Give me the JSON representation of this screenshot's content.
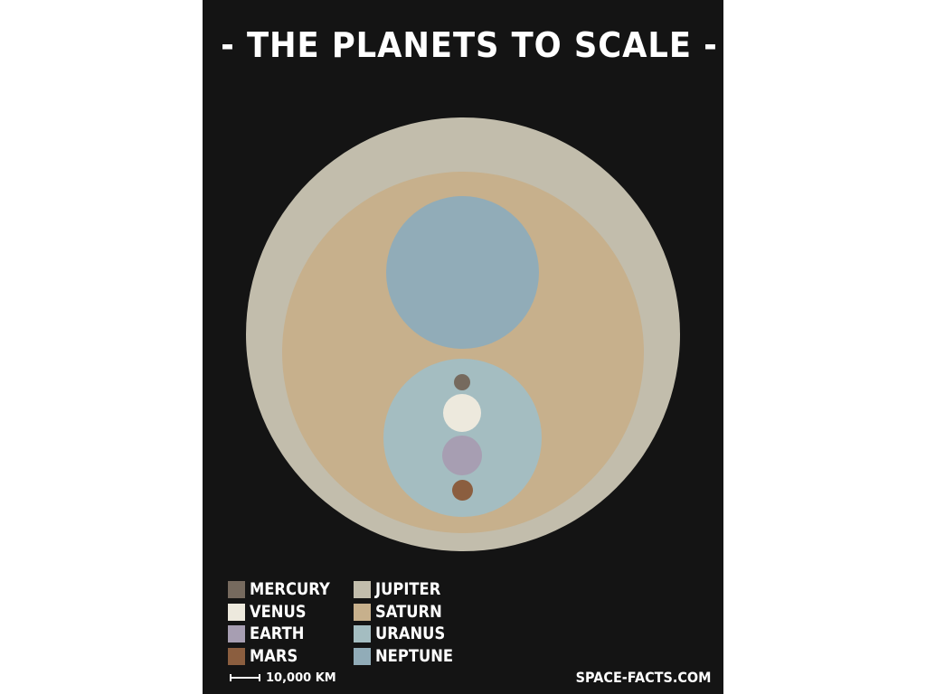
{
  "title": "- THE PLANETS TO SCALE -",
  "planets": {
    "jupiter": {
      "name": "JUPITER",
      "color": "#c2bdac"
    },
    "saturn": {
      "name": "SATURN",
      "color": "#c7b08c"
    },
    "uranus": {
      "name": "URANUS",
      "color": "#a4bdc1"
    },
    "neptune": {
      "name": "NEPTUNE",
      "color": "#91acb8"
    },
    "mercury": {
      "name": "MERCURY",
      "color": "#766a5e"
    },
    "venus": {
      "name": "VENUS",
      "color": "#ede9dd"
    },
    "earth": {
      "name": "EARTH",
      "color": "#a79eb2"
    },
    "mars": {
      "name": "MARS",
      "color": "#8b5e3f"
    }
  },
  "legend": [
    {
      "label": "MERCURY",
      "color": "#766a5e"
    },
    {
      "label": "VENUS",
      "color": "#ede9dd"
    },
    {
      "label": "EARTH",
      "color": "#a79eb2"
    },
    {
      "label": "MARS",
      "color": "#8b5e3f"
    },
    {
      "label": "JUPITER",
      "color": "#c2bdac"
    },
    {
      "label": "SATURN",
      "color": "#c7b08c"
    },
    {
      "label": "URANUS",
      "color": "#a4bdc1"
    },
    {
      "label": "NEPTUNE",
      "color": "#91acb8"
    }
  ],
  "scale_label": "10,000 KM",
  "credit": "SPACE-FACTS.COM"
}
